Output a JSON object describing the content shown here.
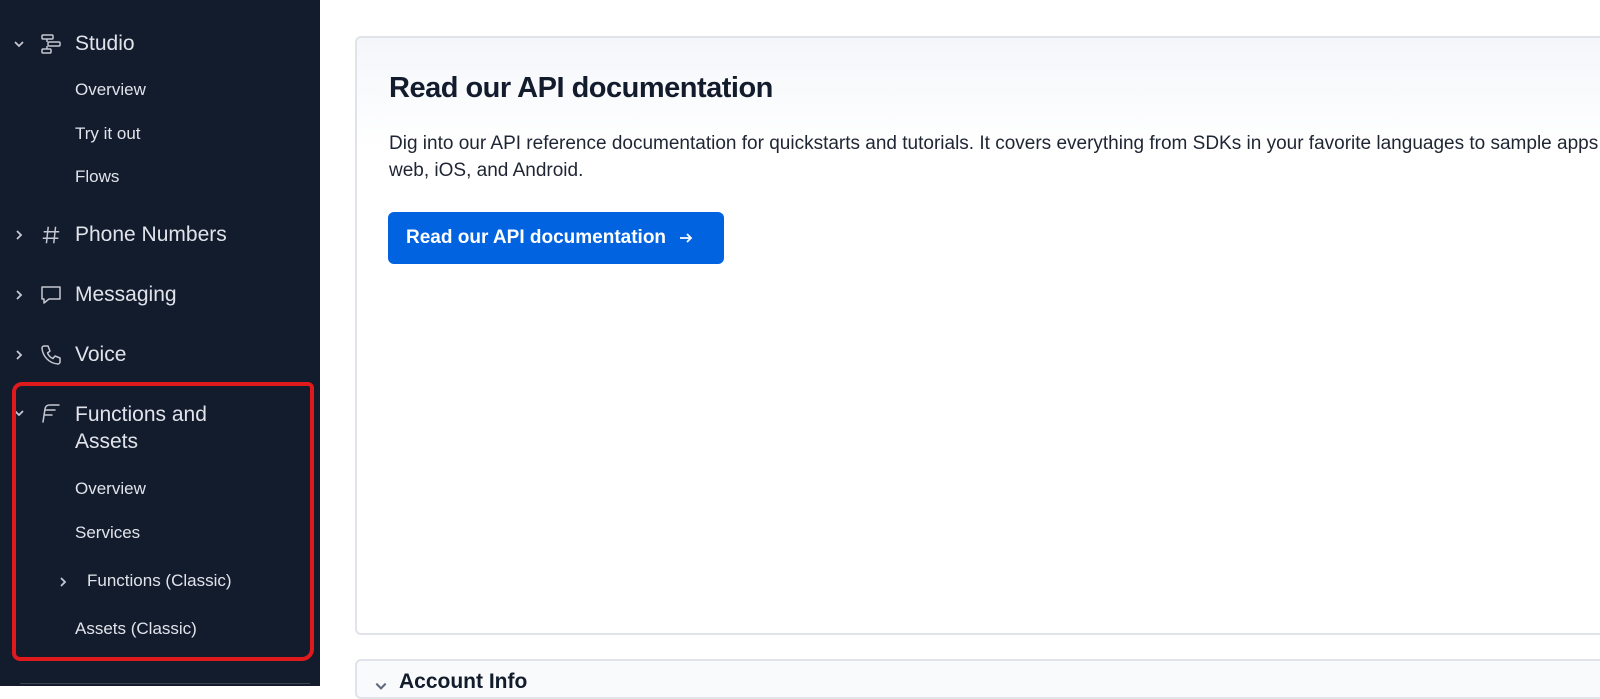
{
  "sidebar": {
    "studio": {
      "label": "Studio",
      "icon": "flow-icon",
      "items": [
        "Overview",
        "Try it out",
        "Flows"
      ]
    },
    "phone_numbers": {
      "label": "Phone Numbers",
      "icon": "hash-icon"
    },
    "messaging": {
      "label": "Messaging",
      "icon": "chat-icon"
    },
    "voice": {
      "label": "Voice",
      "icon": "phone-icon"
    },
    "functions": {
      "label_line1": "Functions and",
      "label_line2": "Assets",
      "icon": "functions-icon",
      "items": [
        "Overview",
        "Services",
        "Functions (Classic)",
        "Assets (Classic)"
      ]
    }
  },
  "highlight_color": "#e0191d",
  "main": {
    "card": {
      "title": "Read our API documentation",
      "description": "Dig into our API reference documentation for quickstarts and tutorials. It covers everything from SDKs in your favorite languages to sample apps for web, iOS, and Android.",
      "button_label": "Read our API documentation",
      "button_color": "#0263e0"
    },
    "account_info": {
      "title": "Account Info"
    }
  }
}
